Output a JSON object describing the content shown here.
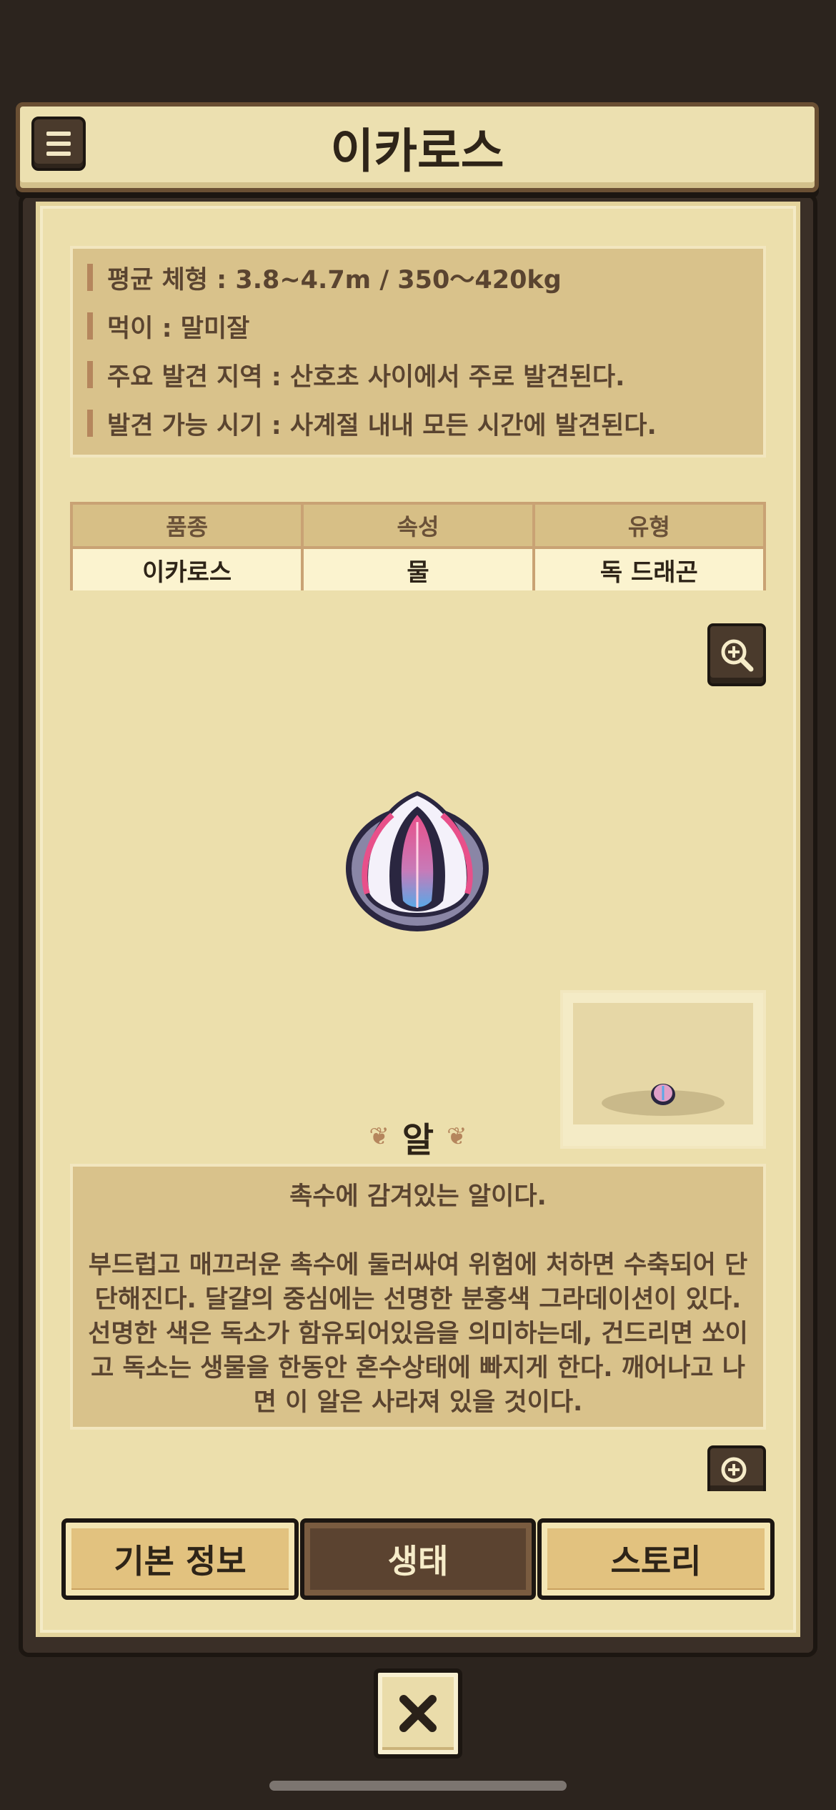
{
  "header": {
    "title": "이카로스",
    "menu_icon": "hamburger-icon"
  },
  "info": {
    "lines": [
      "평균 체형 : 3.8~4.7m / 350～420kg",
      "먹이 : 말미잘",
      "주요 발견 지역 : 산호초 사이에서 주로 발견된다.",
      "발견 가능 시기 : 사계절 내내 모든 시간에 발견된다."
    ]
  },
  "table": {
    "headers": [
      "품종",
      "속성",
      "유형"
    ],
    "values": [
      "이카로스",
      "물",
      "독 드래곤"
    ]
  },
  "stage": {
    "label": "알"
  },
  "description": {
    "first": "촉수에 감겨있는 알이다.",
    "body": "부드럽고 매끄러운 촉수에 둘러싸여 위험에 처하면 수축되어 단단해진다. 달걀의 중심에는 선명한 분홍색 그라데이션이 있다. 선명한 색은 독소가 함유되어있음을 의미하는데, 건드리면 쏘이고 독소는 생물을 한동안 혼수상태에 빠지게 한다. 깨어나고 나면 이 알은 사라져 있을 것이다."
  },
  "tabs": [
    {
      "label": "기본 정보",
      "active": false
    },
    {
      "label": "생태",
      "active": true
    },
    {
      "label": "스토리",
      "active": false
    }
  ],
  "colors": {
    "parchment": "#ecdfac",
    "dark_wood": "#4a3a2c",
    "accent_pink": "#e8508a",
    "accent_blue": "#5aa8e6"
  }
}
